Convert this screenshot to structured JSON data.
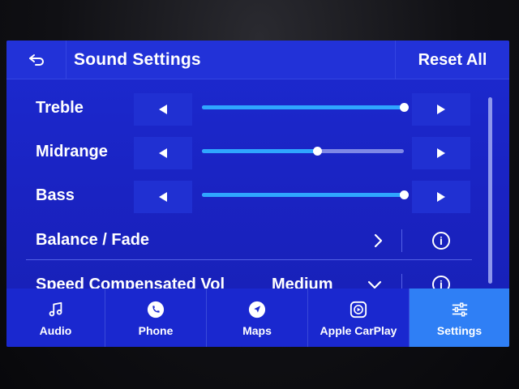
{
  "header": {
    "title": "Sound Settings",
    "back_icon": "back-arrow-icon",
    "reset_label": "Reset All"
  },
  "sliders": [
    {
      "label": "Treble",
      "level": 1.0
    },
    {
      "label": "Midrange",
      "level": 0.57
    },
    {
      "label": "Bass",
      "level": 1.0
    }
  ],
  "balance_fade": {
    "label": "Balance / Fade"
  },
  "speed_comp": {
    "label": "Speed Compensated Vol",
    "value": "Medium"
  },
  "nav": {
    "tabs": [
      {
        "label": "Audio",
        "icon": "music-note-icon"
      },
      {
        "label": "Phone",
        "icon": "phone-icon"
      },
      {
        "label": "Maps",
        "icon": "navigation-icon"
      },
      {
        "label": "Apple CarPlay",
        "icon": "carplay-icon"
      },
      {
        "label": "Settings",
        "icon": "sliders-icon"
      }
    ],
    "active": "Settings"
  },
  "colors": {
    "background": "#1a23c2",
    "slider_fill": "#2fa6ff",
    "active_tab": "#2f7ff5"
  }
}
